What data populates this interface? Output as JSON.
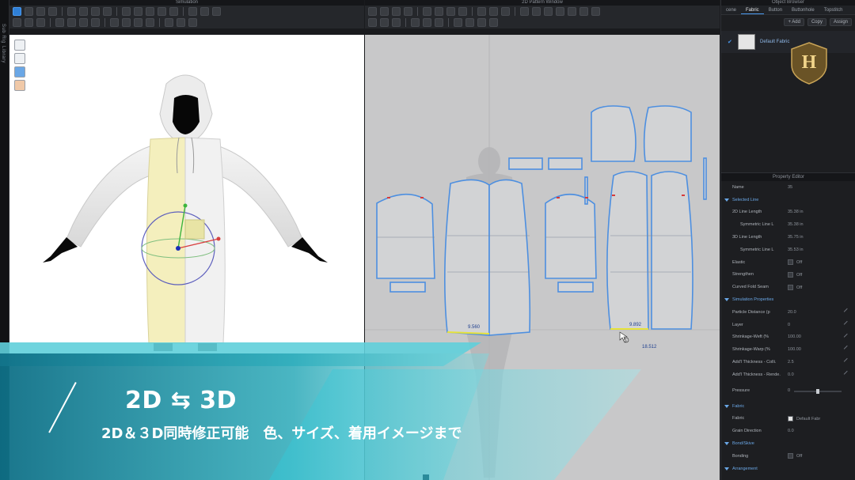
{
  "left_strip": {
    "tabs": [
      "Sub Rig",
      "Library"
    ]
  },
  "window_3d": {
    "title": "Simulation"
  },
  "window_2d": {
    "title": "2D Pattern Window"
  },
  "measurements": {
    "front_hem": "9.560",
    "back_hem": "9.892",
    "back_total": "18.512"
  },
  "object_browser": {
    "title": "Object Browser",
    "tabs": [
      "cene",
      "Fabric",
      "Button",
      "Buttonhole",
      "Topstitch"
    ],
    "active_tab": "Fabric",
    "actions": [
      "+ Add",
      "Copy",
      "Assign"
    ],
    "fabric_name": "Default Fabric",
    "logo_letter": "H"
  },
  "property_editor": {
    "title": "Property Editor",
    "name_label": "Name",
    "name_value": "35",
    "sections": {
      "selected_line": "Selected Line",
      "simulation_properties": "Simulation Properties",
      "fabric": "Fabric",
      "bonding": "Bond/Skive",
      "arrangement": "Arrangement"
    },
    "rows": {
      "line_2d_length": {
        "label": "2D Line Length",
        "value": "35.38 in"
      },
      "symmetric_line_a": {
        "label": "Symmetric Line L",
        "value": "35.38 in"
      },
      "line_3d_length": {
        "label": "3D Line Length",
        "value": "35.75 in"
      },
      "symmetric_line_b": {
        "label": "Symmetric Line L",
        "value": "35.53 in"
      },
      "elastic": {
        "label": "Elastic",
        "value": "Off"
      },
      "strengthen": {
        "label": "Strengthen",
        "value": "Off"
      },
      "curved_fold": {
        "label": "Curved Fold Seam",
        "value": "Off"
      },
      "particle_distance": {
        "label": "Particle Distance (p",
        "value": "20.0"
      },
      "layer": {
        "label": "Layer",
        "value": "0"
      },
      "shrinkage_weft": {
        "label": "Shrinkage-Weft (%",
        "value": "100.00"
      },
      "shrinkage_warp": {
        "label": "Shrinkage-Warp (%",
        "value": "100.00"
      },
      "add_thickness_coll": {
        "label": "Add'l Thickness - Colli.",
        "value": "2.5"
      },
      "add_thickness_render": {
        "label": "Add'l Thickness - Rende.",
        "value": "0.0"
      },
      "pressure": {
        "label": "Pressure",
        "value": "0"
      },
      "fabric_label": {
        "label": "Fabric",
        "value": "Default Fabr"
      },
      "grain_direction": {
        "label": "Grain Direction",
        "value": "0.0"
      },
      "bonding_skive": {
        "label": "Bonding",
        "value": "Off"
      }
    }
  },
  "banner": {
    "title": "2D ⇆ 3D",
    "subtitle": "2D＆３D同時修正可能　色、サイズ、着用イメージまで"
  }
}
